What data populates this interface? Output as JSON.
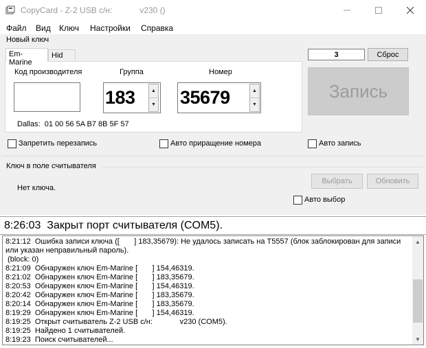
{
  "window": {
    "title": "CopyCard - Z-2 USB с/н:            v230 ()"
  },
  "icons": {
    "app": "app-card-icon",
    "minimize": "minimize-icon",
    "maximize": "maximize-icon",
    "close": "close-icon"
  },
  "menu": [
    "Файл",
    "Вид",
    "Ключ",
    "Настройки",
    "Справка"
  ],
  "new_key": {
    "group_label": "Новый ключ",
    "tabs": [
      "Em-Marine",
      "Hid"
    ],
    "manufacturer_label": "Код производителя",
    "manufacturer_value": "",
    "group_field_label": "Группа",
    "group_value": "183",
    "number_label": "Номер",
    "number_value": "35679",
    "dallas": "Dallas:  01 00 56 5A B7 8B 5F 57"
  },
  "counter": {
    "value": "3",
    "reset_label": "Сброс"
  },
  "write_button": "Запись",
  "options": {
    "no_overwrite": "Запретить перезапись",
    "auto_increment": "Авто приращение номера",
    "auto_write": "Авто запись"
  },
  "reader": {
    "group_label": "Ключ в поле считывателя",
    "status": "Нет ключа.",
    "select_label": "Выбрать",
    "refresh_label": "Обновить",
    "auto_select": "Авто выбор"
  },
  "status_line": "8:26:03  Закрыт порт считывателя (COM5).",
  "log": [
    "8:21:12  Ошибка записи ключа ([       ] 183,35679): Не удалось записать на T5557 (блок заблокирован для записи",
    "или указан неправильный пароль).",
    " (block: 0)",
    "8:21:09  Обнаружен ключ Em-Marine [       ] 154,46319.",
    "8:21:02  Обнаружен ключ Em-Marine [       ] 183,35679.",
    "8:20:53  Обнаружен ключ Em-Marine [       ] 154,46319.",
    "8:20:42  Обнаружен ключ Em-Marine [       ] 183,35679.",
    "8:20:14  Обнаружен ключ Em-Marine [       ] 183,35679.",
    "8:19:29  Обнаружен ключ Em-Marine [       ] 154,46319.",
    "8:19:25  Открыт считыватель Z-2 USB с/н:             v230 (COM5).",
    "8:19:25  Найдено 1 считывателей.",
    "8:19:23  Поиск считывателей..."
  ]
}
